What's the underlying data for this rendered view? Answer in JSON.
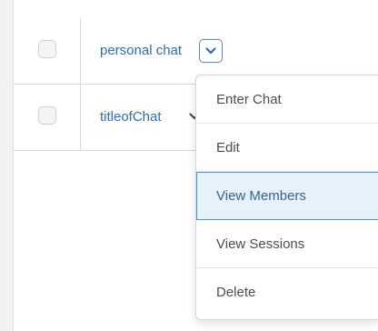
{
  "rows": [
    {
      "name": "personal chat"
    },
    {
      "name": "titleofChat"
    }
  ],
  "menu": {
    "items": [
      {
        "label": "Enter Chat"
      },
      {
        "label": "Edit"
      },
      {
        "label": "View Members"
      },
      {
        "label": "View Sessions"
      },
      {
        "label": "Delete"
      }
    ],
    "active_index": 2
  },
  "colors": {
    "link": "#2e6db4",
    "accent": "#4a90d9",
    "active_bg": "#e6f2fb",
    "text": "#494c55"
  }
}
